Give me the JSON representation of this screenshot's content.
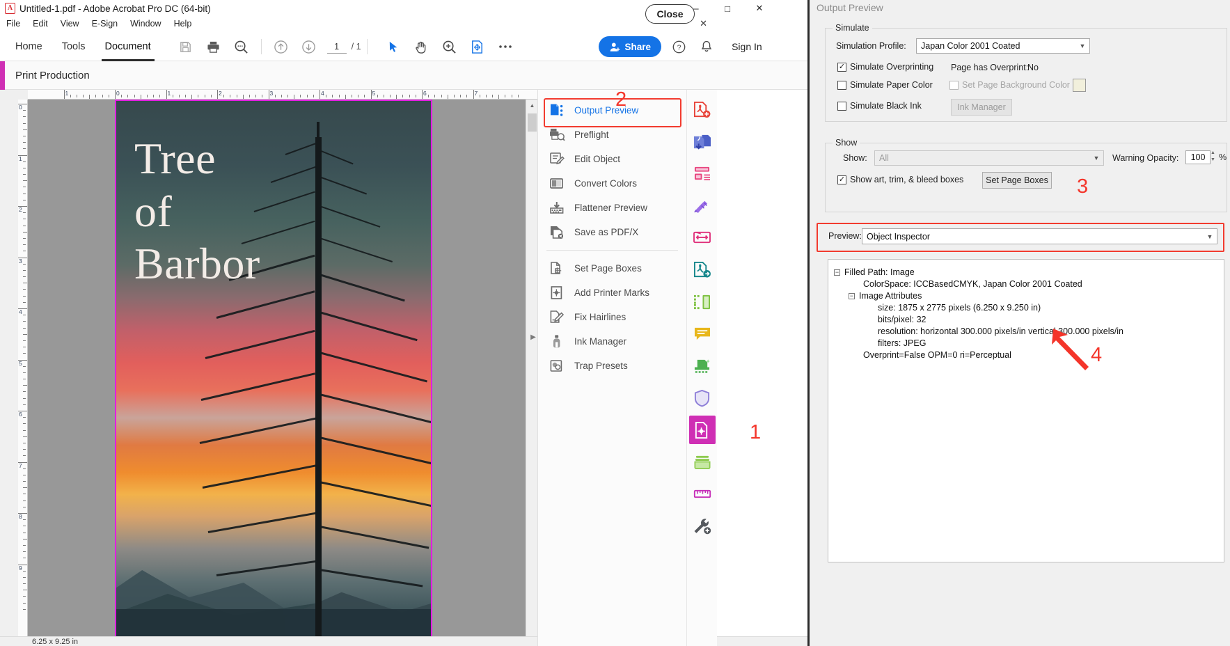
{
  "window": {
    "title": "Untitled-1.pdf - Adobe Acrobat Pro DC (64-bit)",
    "minimize": "─",
    "maximize": "□",
    "close": "✕",
    "panel_close": "✕"
  },
  "menubar": {
    "items": [
      "File",
      "Edit",
      "View",
      "E-Sign",
      "Window",
      "Help"
    ]
  },
  "toolbar": {
    "tabs": [
      {
        "label": "Home",
        "active": false
      },
      {
        "label": "Tools",
        "active": false
      },
      {
        "label": "Document",
        "active": true
      }
    ],
    "page_current": "1",
    "page_total": "/ 1",
    "share_label": "Share",
    "signin_label": "Sign In"
  },
  "print_production": {
    "header": "Print Production",
    "close_label": "Close",
    "items": [
      {
        "label": "Output Preview",
        "selected": true
      },
      {
        "label": "Preflight",
        "selected": false
      },
      {
        "label": "Edit Object",
        "selected": false
      },
      {
        "label": "Convert Colors",
        "selected": false
      },
      {
        "label": "Flattener Preview",
        "selected": false
      },
      {
        "label": "Save as PDF/X",
        "selected": false
      }
    ],
    "items2": [
      {
        "label": "Set Page Boxes"
      },
      {
        "label": "Add Printer Marks"
      },
      {
        "label": "Fix Hairlines"
      },
      {
        "label": "Ink Manager"
      },
      {
        "label": "Trap Presets"
      }
    ]
  },
  "document": {
    "page_title_lines": [
      "Tree",
      "of",
      "Barbor"
    ],
    "ruler_h": [
      "1",
      "0",
      "1",
      "2",
      "3",
      "4",
      "5",
      "6",
      "7"
    ],
    "ruler_v": [
      "0",
      "1",
      "2",
      "3",
      "4",
      "5",
      "6",
      "7",
      "8",
      "9"
    ],
    "status_size": "6.25 x 9.25 in"
  },
  "output_preview": {
    "title": "Output Preview",
    "simulate": {
      "group_label": "Simulate",
      "profile_label": "Simulation Profile:",
      "profile_value": "Japan Color 2001 Coated",
      "overprint_label": "Simulate Overprinting",
      "overprint_checked": true,
      "page_overprint_label": "Page has Overprint:",
      "page_overprint_value": "No",
      "paper_color_label": "Simulate Paper Color",
      "paper_color_checked": false,
      "set_bg_label": "Set Page Background Color",
      "set_bg_checked": false,
      "black_ink_label": "Simulate Black Ink",
      "black_ink_checked": false,
      "ink_manager_label": "Ink Manager"
    },
    "show": {
      "group_label": "Show",
      "show_label": "Show:",
      "show_value": "All",
      "warning_opacity_label": "Warning Opacity:",
      "warning_opacity_value": "100",
      "percent": "%",
      "boxes_label": "Show art, trim, & bleed boxes",
      "boxes_checked": true,
      "set_page_boxes_label": "Set Page Boxes"
    },
    "preview": {
      "label": "Preview:",
      "value": "Object Inspector"
    },
    "inspector": {
      "root": "Filled Path: Image",
      "colorspace": "ColorSpace: ICCBasedCMYK, Japan Color 2001 Coated",
      "attributes_label": "Image Attributes",
      "size": "size: 1875 x 2775 pixels (6.250 x 9.250 in)",
      "bits": "bits/pixel: 32",
      "resolution": "resolution: horizontal 300.000 pixels/in vertical 300.000 pixels/in",
      "filters": "filters: JPEG",
      "overprint": "Overprint=False OPM=0 ri=Perceptual"
    }
  },
  "annotations": [
    {
      "num": "1"
    },
    {
      "num": "2"
    },
    {
      "num": "3"
    },
    {
      "num": "4"
    }
  ],
  "colors": {
    "accent_blue": "#1473e6",
    "annotation_red": "#f4352a",
    "pp_accent": "#cf2fb4",
    "page_border": "#e11ee1"
  }
}
